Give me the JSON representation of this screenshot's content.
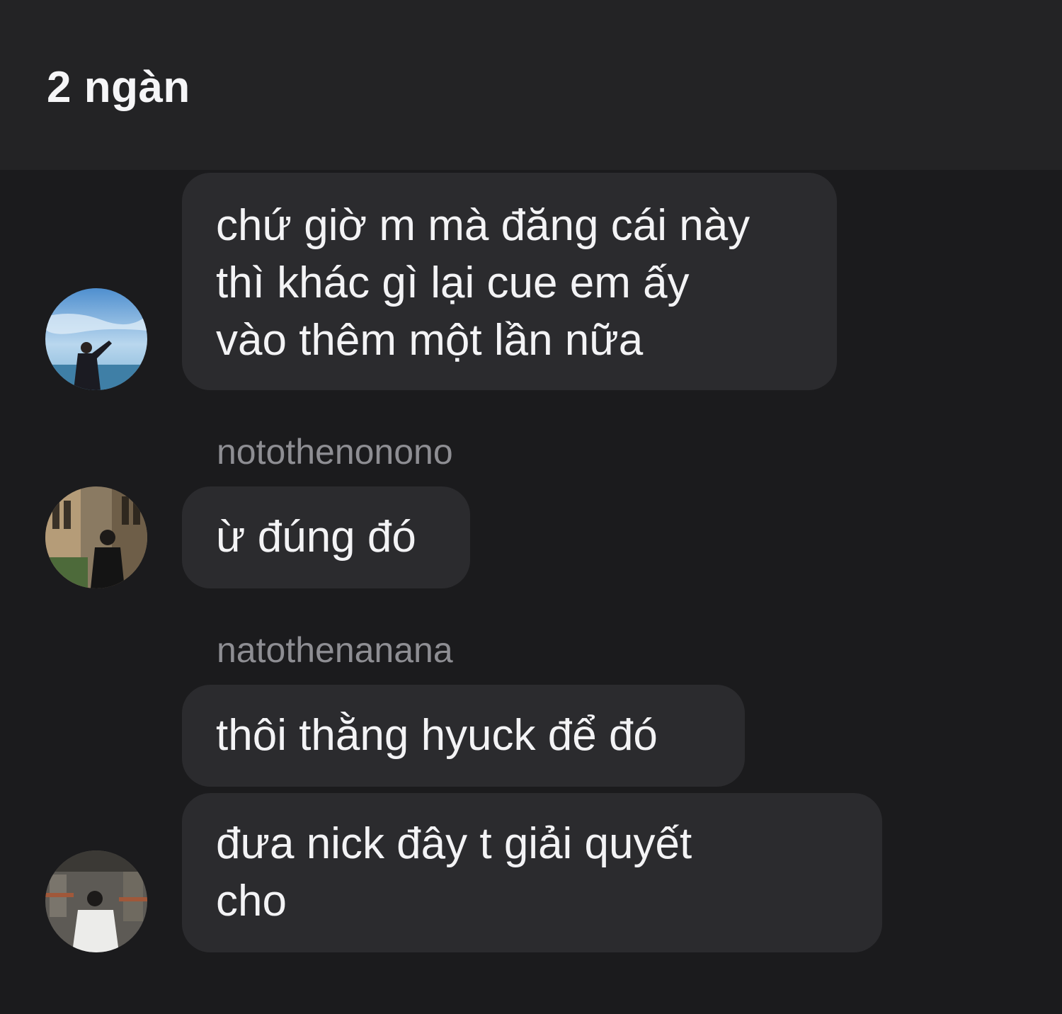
{
  "header": {
    "title": "2 ngàn"
  },
  "messages": [
    {
      "text": "chứ giờ m mà đăng cái này\nthì khác gì lại cue em ấy\nvào thêm một lần nữa",
      "avatar": "avatar-sky-photo"
    },
    {
      "sender": "notothenonono",
      "text": "ừ đúng đó",
      "avatar": "avatar-street-photo"
    },
    {
      "sender": "natothenanana",
      "text": "thôi thằng hyuck để đó"
    },
    {
      "text": "đưa nick đây t giải quyết\ncho",
      "avatar": "avatar-market-photo"
    }
  ],
  "colors": {
    "background": "#1b1b1d",
    "header_background": "#232325",
    "bubble": "#2b2b2e",
    "sender_text": "#8e8e93",
    "text": "#f3f3f5"
  }
}
